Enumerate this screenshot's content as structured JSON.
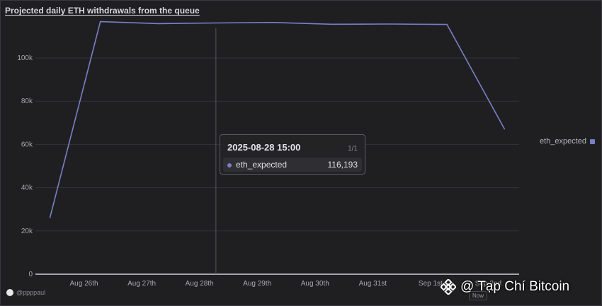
{
  "title": "Projected daily ETH withdrawals from the queue",
  "legend": {
    "label": "eth_expected",
    "color": "#7b7fc4"
  },
  "tooltip": {
    "date": "2025-08-28 15:00",
    "page": "1/1",
    "series": "eth_expected",
    "value": "116,193"
  },
  "footer": {
    "user": "@ppppaul",
    "now": "Now"
  },
  "watermark": {
    "text": "@ Tạp Chí Bitcoin",
    "icon": "binance-diamond-icon"
  },
  "chart_data": {
    "type": "line",
    "title": "Projected daily ETH withdrawals from the queue",
    "x_tick_labels": [
      "Aug 26th",
      "Aug 27th",
      "Aug 28th",
      "Aug 29th",
      "Aug 30th",
      "Aug 31st",
      "Sep 1st",
      "Sep 2nd"
    ],
    "y_tick_labels": [
      "0",
      "20k",
      "40k",
      "60k",
      "80k",
      "100k"
    ],
    "ylim": [
      0,
      117000
    ],
    "grid": true,
    "legend_position": "right",
    "series": [
      {
        "name": "eth_expected",
        "color": "#7b7fc4",
        "points": [
          {
            "x": "2025-08-25 18:00",
            "y": 26000
          },
          {
            "x": "2025-08-26 15:00",
            "y": 116800
          },
          {
            "x": "2025-08-27 15:00",
            "y": 115900
          },
          {
            "x": "2025-08-28 15:00",
            "y": 116193
          },
          {
            "x": "2025-08-29 15:00",
            "y": 116400
          },
          {
            "x": "2025-08-30 15:00",
            "y": 115600
          },
          {
            "x": "2025-08-31 15:00",
            "y": 115700
          },
          {
            "x": "2025-09-01 15:00",
            "y": 115500
          },
          {
            "x": "2025-09-02 15:00",
            "y": 67000
          }
        ]
      }
    ],
    "hover_x": "2025-08-28 15:00"
  }
}
